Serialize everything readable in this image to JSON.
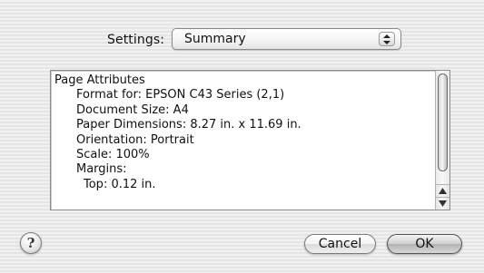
{
  "settings": {
    "label": "Settings:",
    "selected": "Summary"
  },
  "summary": {
    "lines": [
      {
        "text": "Page Attributes",
        "indent": 0
      },
      {
        "text": "Format for:  EPSON C43 Series (2,1)",
        "indent": 1
      },
      {
        "text": "Document Size:  A4",
        "indent": 1
      },
      {
        "text": "Paper Dimensions:  8.27 in. x 11.69 in.",
        "indent": 1
      },
      {
        "text": "Orientation:  Portrait",
        "indent": 1
      },
      {
        "text": "Scale:  100%",
        "indent": 1
      },
      {
        "text": "Margins:",
        "indent": 1
      },
      {
        "text": "Top:  0.12 in.",
        "indent": 2
      }
    ]
  },
  "buttons": {
    "help": "?",
    "cancel": "Cancel",
    "ok": "OK"
  }
}
